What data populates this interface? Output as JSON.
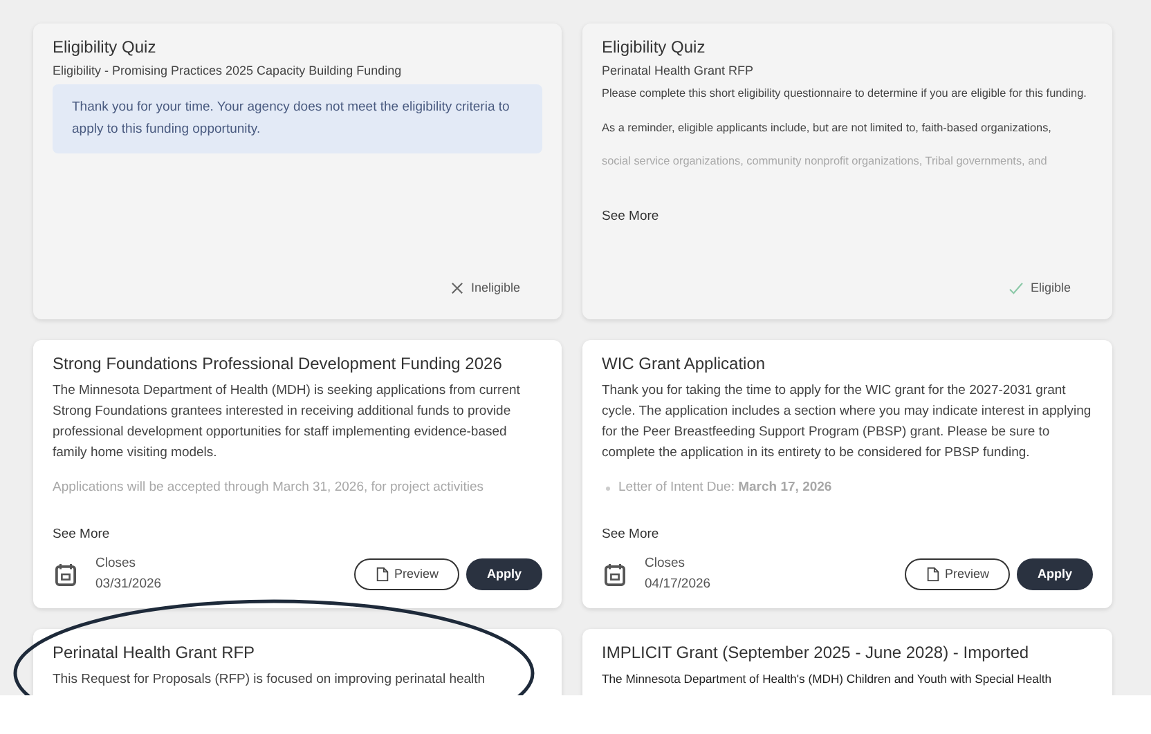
{
  "cards": [
    {
      "kind": "quiz",
      "title": "Eligibility Quiz",
      "subtitle": "Eligibility - Promising Practices 2025 Capacity Building Funding",
      "notice": "Thank you for your time. Your agency does not meet the eligibility criteria to apply to this funding opportunity.",
      "status": {
        "kind": "ineligible",
        "label": "Ineligible"
      }
    },
    {
      "kind": "quiz",
      "title": "Eligibility Quiz",
      "subtitle": "Perinatal Health Grant RFP",
      "body": [
        {
          "text": "Please complete this short eligibility questionnaire to determine if you are eligible for this funding.",
          "faded": false
        },
        {
          "text": "As a reminder, eligible applicants include, but are not limited to, faith-based organizations,",
          "faded": false
        },
        {
          "text": "social service organizations, community nonprofit organizations, Tribal governments, and",
          "faded": true
        }
      ],
      "see_more": "See More",
      "status": {
        "kind": "eligible",
        "label": "Eligible"
      }
    },
    {
      "kind": "grant",
      "title": "Strong Foundations Professional Development Funding 2026",
      "body": [
        {
          "text": "The Minnesota Department of Health (MDH) is seeking applications from current Strong Foundations grantees interested in receiving additional funds to provide professional development opportunities for staff implementing evidence-based family home visiting models.",
          "faded": false
        },
        {
          "text": "Applications will be accepted through March 31, 2026, for project activities",
          "faded": true
        }
      ],
      "see_more": "See More",
      "closes_label": "Closes",
      "closes_date": "03/31/2026",
      "buttons": [
        {
          "kind": "outline",
          "label": "Preview"
        },
        {
          "kind": "solid",
          "label": "Apply"
        }
      ]
    },
    {
      "kind": "grant",
      "title": "WIC Grant Application",
      "body": [
        {
          "text": "Thank you for taking the time to apply for the WIC grant for the 2027-2031 grant cycle. The application includes a section where you may indicate interest in applying for the Peer Breastfeeding Support Program (PBSP) grant. Please be sure to complete the application in its entirety to be considered for PBSP funding.",
          "faded": false
        },
        {
          "text": "Letter of Intent Due: **March 17, 2026**",
          "faded": true,
          "bullet": true
        }
      ],
      "see_more": "See More",
      "closes_label": "Closes",
      "closes_date": "04/17/2026",
      "buttons": [
        {
          "kind": "outline",
          "label": "Preview"
        },
        {
          "kind": "solid",
          "label": "Apply"
        }
      ]
    },
    {
      "kind": "grant",
      "title": "Perinatal Health Grant RFP",
      "body": [
        {
          "text": "This Request for Proposals (RFP) is focused on improving perinatal health",
          "faded": false
        }
      ]
    },
    {
      "kind": "grant",
      "title": "IMPLICIT Grant (September 2025 - June 2028) - Imported",
      "body": [
        {
          "text": "The Minnesota Department of Health's (MDH) Children and Youth with Special Health",
          "faded": false,
          "dark": true
        }
      ]
    }
  ]
}
